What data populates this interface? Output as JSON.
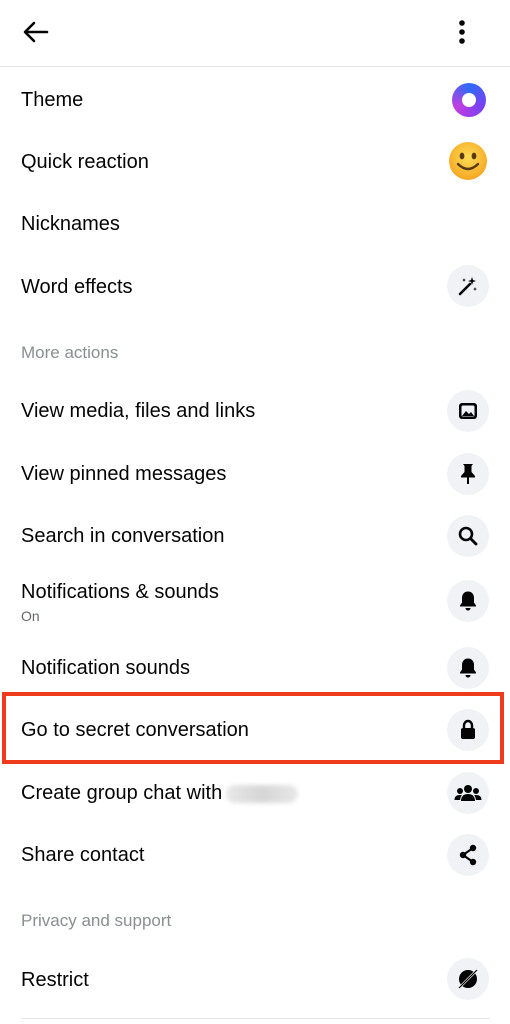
{
  "header": {
    "back_icon": "arrow-left-icon",
    "more_icon": "vertical-ellipsis-icon"
  },
  "settings": {
    "theme": {
      "label": "Theme",
      "icon": "theme-circle-icon",
      "color": "#7b3ff2"
    },
    "quick_reaction": {
      "label": "Quick reaction",
      "icon": "smiley-emoji-icon"
    },
    "nicknames": {
      "label": "Nicknames"
    },
    "word_effects": {
      "label": "Word effects",
      "icon": "magic-wand-icon"
    }
  },
  "more_actions": {
    "header": "More actions",
    "items": [
      {
        "label": "View media, files and links",
        "icon": "image-icon"
      },
      {
        "label": "View pinned messages",
        "icon": "pin-icon"
      },
      {
        "label": "Search in conversation",
        "icon": "search-icon"
      },
      {
        "label": "Notifications  & sounds",
        "sublabel": "On",
        "icon": "bell-icon"
      },
      {
        "label": "Notification sounds",
        "icon": "bell-icon"
      },
      {
        "label": "Go to secret conversation",
        "icon": "lock-icon"
      },
      {
        "label": "Create group chat with",
        "icon": "group-icon"
      },
      {
        "label": "Share contact",
        "icon": "share-icon"
      }
    ]
  },
  "privacy_support": {
    "header": "Privacy and support",
    "items": [
      {
        "label": "Restrict",
        "icon": "restrict-icon"
      }
    ]
  },
  "colors": {
    "highlight": "#ee3b1c",
    "icon_bg": "#f0f2f5",
    "section_text": "#8a8d91"
  }
}
